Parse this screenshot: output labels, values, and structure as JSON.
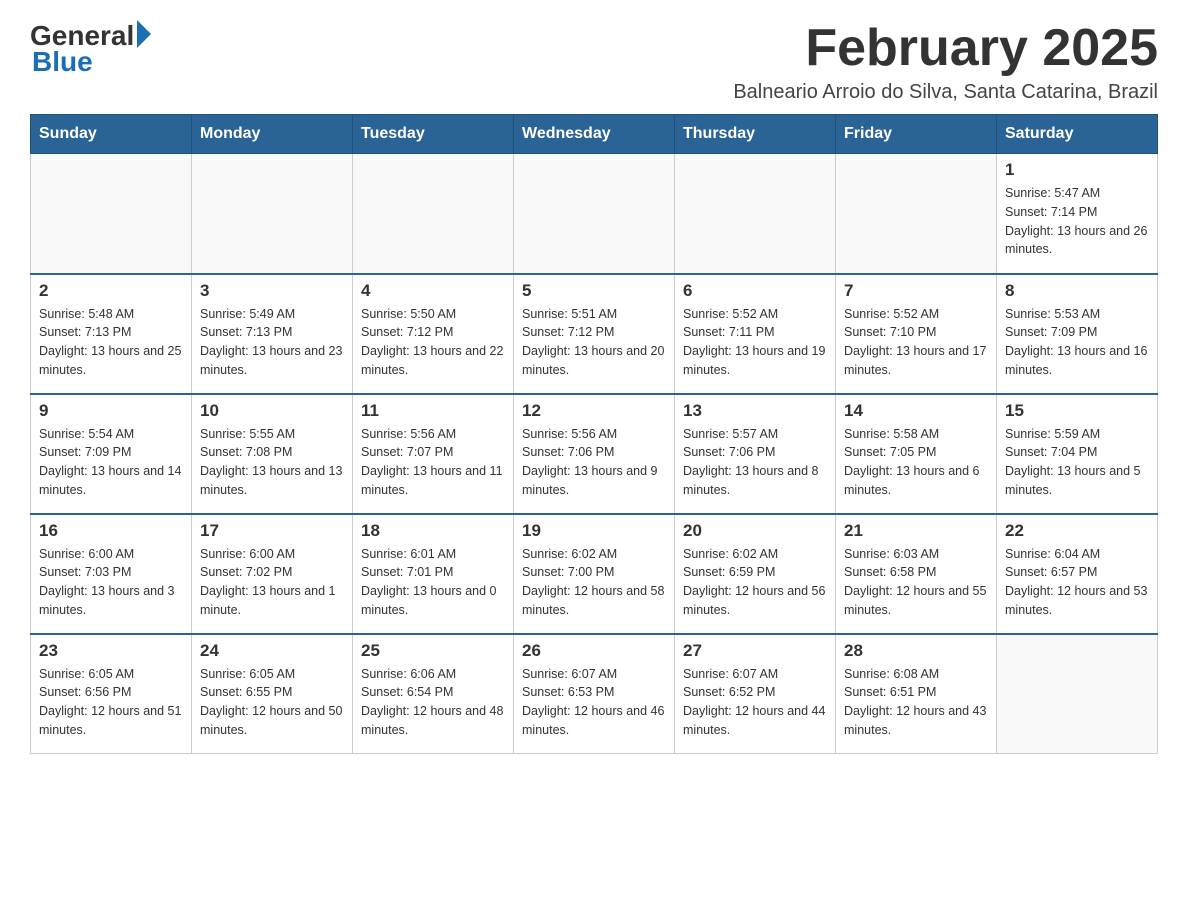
{
  "logo": {
    "general": "General",
    "blue": "Blue"
  },
  "header": {
    "title": "February 2025",
    "location": "Balneario Arroio do Silva, Santa Catarina, Brazil"
  },
  "weekdays": [
    "Sunday",
    "Monday",
    "Tuesday",
    "Wednesday",
    "Thursday",
    "Friday",
    "Saturday"
  ],
  "weeks": [
    [
      {
        "day": "",
        "info": ""
      },
      {
        "day": "",
        "info": ""
      },
      {
        "day": "",
        "info": ""
      },
      {
        "day": "",
        "info": ""
      },
      {
        "day": "",
        "info": ""
      },
      {
        "day": "",
        "info": ""
      },
      {
        "day": "1",
        "info": "Sunrise: 5:47 AM\nSunset: 7:14 PM\nDaylight: 13 hours and 26 minutes."
      }
    ],
    [
      {
        "day": "2",
        "info": "Sunrise: 5:48 AM\nSunset: 7:13 PM\nDaylight: 13 hours and 25 minutes."
      },
      {
        "day": "3",
        "info": "Sunrise: 5:49 AM\nSunset: 7:13 PM\nDaylight: 13 hours and 23 minutes."
      },
      {
        "day": "4",
        "info": "Sunrise: 5:50 AM\nSunset: 7:12 PM\nDaylight: 13 hours and 22 minutes."
      },
      {
        "day": "5",
        "info": "Sunrise: 5:51 AM\nSunset: 7:12 PM\nDaylight: 13 hours and 20 minutes."
      },
      {
        "day": "6",
        "info": "Sunrise: 5:52 AM\nSunset: 7:11 PM\nDaylight: 13 hours and 19 minutes."
      },
      {
        "day": "7",
        "info": "Sunrise: 5:52 AM\nSunset: 7:10 PM\nDaylight: 13 hours and 17 minutes."
      },
      {
        "day": "8",
        "info": "Sunrise: 5:53 AM\nSunset: 7:09 PM\nDaylight: 13 hours and 16 minutes."
      }
    ],
    [
      {
        "day": "9",
        "info": "Sunrise: 5:54 AM\nSunset: 7:09 PM\nDaylight: 13 hours and 14 minutes."
      },
      {
        "day": "10",
        "info": "Sunrise: 5:55 AM\nSunset: 7:08 PM\nDaylight: 13 hours and 13 minutes."
      },
      {
        "day": "11",
        "info": "Sunrise: 5:56 AM\nSunset: 7:07 PM\nDaylight: 13 hours and 11 minutes."
      },
      {
        "day": "12",
        "info": "Sunrise: 5:56 AM\nSunset: 7:06 PM\nDaylight: 13 hours and 9 minutes."
      },
      {
        "day": "13",
        "info": "Sunrise: 5:57 AM\nSunset: 7:06 PM\nDaylight: 13 hours and 8 minutes."
      },
      {
        "day": "14",
        "info": "Sunrise: 5:58 AM\nSunset: 7:05 PM\nDaylight: 13 hours and 6 minutes."
      },
      {
        "day": "15",
        "info": "Sunrise: 5:59 AM\nSunset: 7:04 PM\nDaylight: 13 hours and 5 minutes."
      }
    ],
    [
      {
        "day": "16",
        "info": "Sunrise: 6:00 AM\nSunset: 7:03 PM\nDaylight: 13 hours and 3 minutes."
      },
      {
        "day": "17",
        "info": "Sunrise: 6:00 AM\nSunset: 7:02 PM\nDaylight: 13 hours and 1 minute."
      },
      {
        "day": "18",
        "info": "Sunrise: 6:01 AM\nSunset: 7:01 PM\nDaylight: 13 hours and 0 minutes."
      },
      {
        "day": "19",
        "info": "Sunrise: 6:02 AM\nSunset: 7:00 PM\nDaylight: 12 hours and 58 minutes."
      },
      {
        "day": "20",
        "info": "Sunrise: 6:02 AM\nSunset: 6:59 PM\nDaylight: 12 hours and 56 minutes."
      },
      {
        "day": "21",
        "info": "Sunrise: 6:03 AM\nSunset: 6:58 PM\nDaylight: 12 hours and 55 minutes."
      },
      {
        "day": "22",
        "info": "Sunrise: 6:04 AM\nSunset: 6:57 PM\nDaylight: 12 hours and 53 minutes."
      }
    ],
    [
      {
        "day": "23",
        "info": "Sunrise: 6:05 AM\nSunset: 6:56 PM\nDaylight: 12 hours and 51 minutes."
      },
      {
        "day": "24",
        "info": "Sunrise: 6:05 AM\nSunset: 6:55 PM\nDaylight: 12 hours and 50 minutes."
      },
      {
        "day": "25",
        "info": "Sunrise: 6:06 AM\nSunset: 6:54 PM\nDaylight: 12 hours and 48 minutes."
      },
      {
        "day": "26",
        "info": "Sunrise: 6:07 AM\nSunset: 6:53 PM\nDaylight: 12 hours and 46 minutes."
      },
      {
        "day": "27",
        "info": "Sunrise: 6:07 AM\nSunset: 6:52 PM\nDaylight: 12 hours and 44 minutes."
      },
      {
        "day": "28",
        "info": "Sunrise: 6:08 AM\nSunset: 6:51 PM\nDaylight: 12 hours and 43 minutes."
      },
      {
        "day": "",
        "info": ""
      }
    ]
  ]
}
